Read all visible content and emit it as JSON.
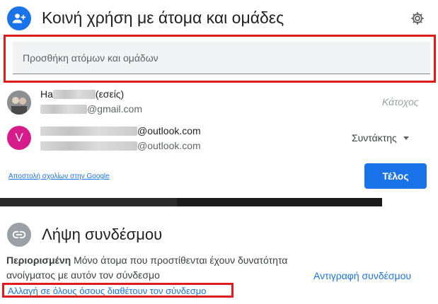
{
  "share": {
    "title": "Κοινή χρήση με άτομα και ομάδες",
    "add_placeholder": "Προσθήκη ατόμων και ομάδων",
    "people": [
      {
        "name_visible": "Ha",
        "name_suffix": "(εσείς)",
        "email_suffix": "@gmail.com",
        "role": "Κάτοχος",
        "avatar": "photo"
      },
      {
        "avatar_letter": "V",
        "name_suffix": "@outlook.com",
        "email_suffix": "@outlook.com",
        "role": "Συντάκτης",
        "avatar_color": "#d81b8a"
      }
    ],
    "feedback_link": "Αποστολή σχολίων στην Google",
    "done_label": "Τέλος"
  },
  "link": {
    "title": "Λήψη συνδέσμου",
    "restriction_label": "Περιορισμένη",
    "restriction_text": " Μόνο άτομα που προστίθενται έχουν δυνατότητα ανοίγματος με αυτόν τον σύνδεσμο",
    "copy_label": "Αντιγραφή συνδέσμου",
    "change_label": "Αλλαγή σε όλους όσους διαθέτουν τον σύνδεσμο"
  },
  "icons": {
    "header": "add-person-icon",
    "settings": "gear-icon",
    "link": "link-icon",
    "dropdown": "chevron-down-icon"
  },
  "colors": {
    "accent": "#1a73e8",
    "highlight": "#e01b1b",
    "avatar_v": "#d81b8a"
  }
}
